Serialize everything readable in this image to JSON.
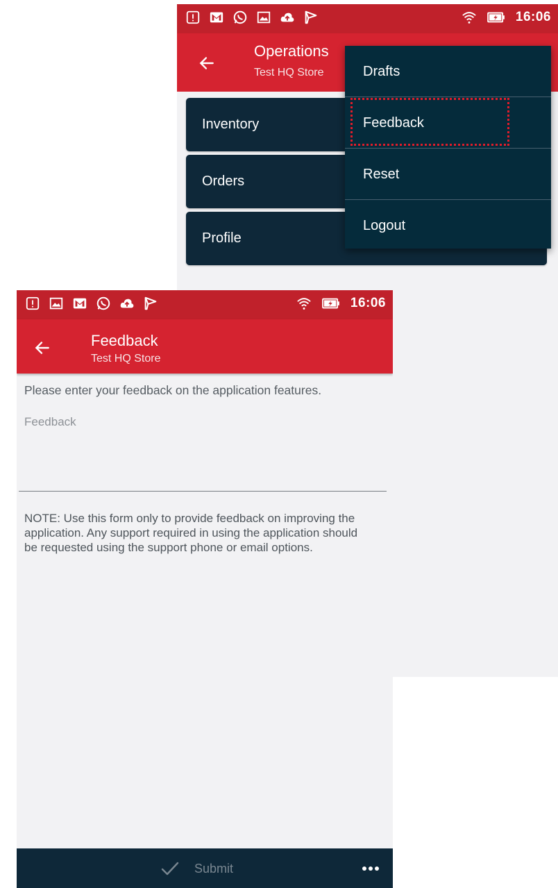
{
  "status_bar": {
    "time": "16:06"
  },
  "operations_screen": {
    "appbar": {
      "title": "Operations",
      "subtitle": "Test HQ Store"
    },
    "cards": [
      {
        "label": "Inventory"
      },
      {
        "label": "Orders"
      },
      {
        "label": "Profile"
      }
    ],
    "menu": {
      "items": [
        {
          "label": "Drafts"
        },
        {
          "label": "Feedback"
        },
        {
          "label": "Reset"
        },
        {
          "label": "Logout"
        }
      ],
      "highlighted_item": "Feedback"
    }
  },
  "feedback_screen": {
    "appbar": {
      "title": "Feedback",
      "subtitle": "Test HQ Store"
    },
    "instructions": "Please enter your feedback on the application features.",
    "feedback_field": {
      "placeholder": "Feedback",
      "value": ""
    },
    "note": "NOTE: Use this form only to provide feedback on improving the application. Any support required in using the application should be requested using the support phone or email options.",
    "bottom_bar": {
      "submit_label": "Submit"
    }
  },
  "colors": {
    "status_bar": "#c0212b",
    "app_bar": "#d52330",
    "dark_navy": "#0e2839",
    "menu_bg": "#052b3b",
    "background": "#f2f2f4",
    "highlight": "#e11c2a"
  },
  "icons": {
    "status_left": [
      "alert-icon",
      "gmail-icon",
      "whatsapp-icon",
      "gallery-icon",
      "cloud-upload-icon",
      "flag-icon"
    ],
    "status_right": [
      "wifi-icon",
      "battery-icon"
    ],
    "back": "arrow-left-icon",
    "submit": "check-icon",
    "more": "more-horizontal-icon"
  }
}
